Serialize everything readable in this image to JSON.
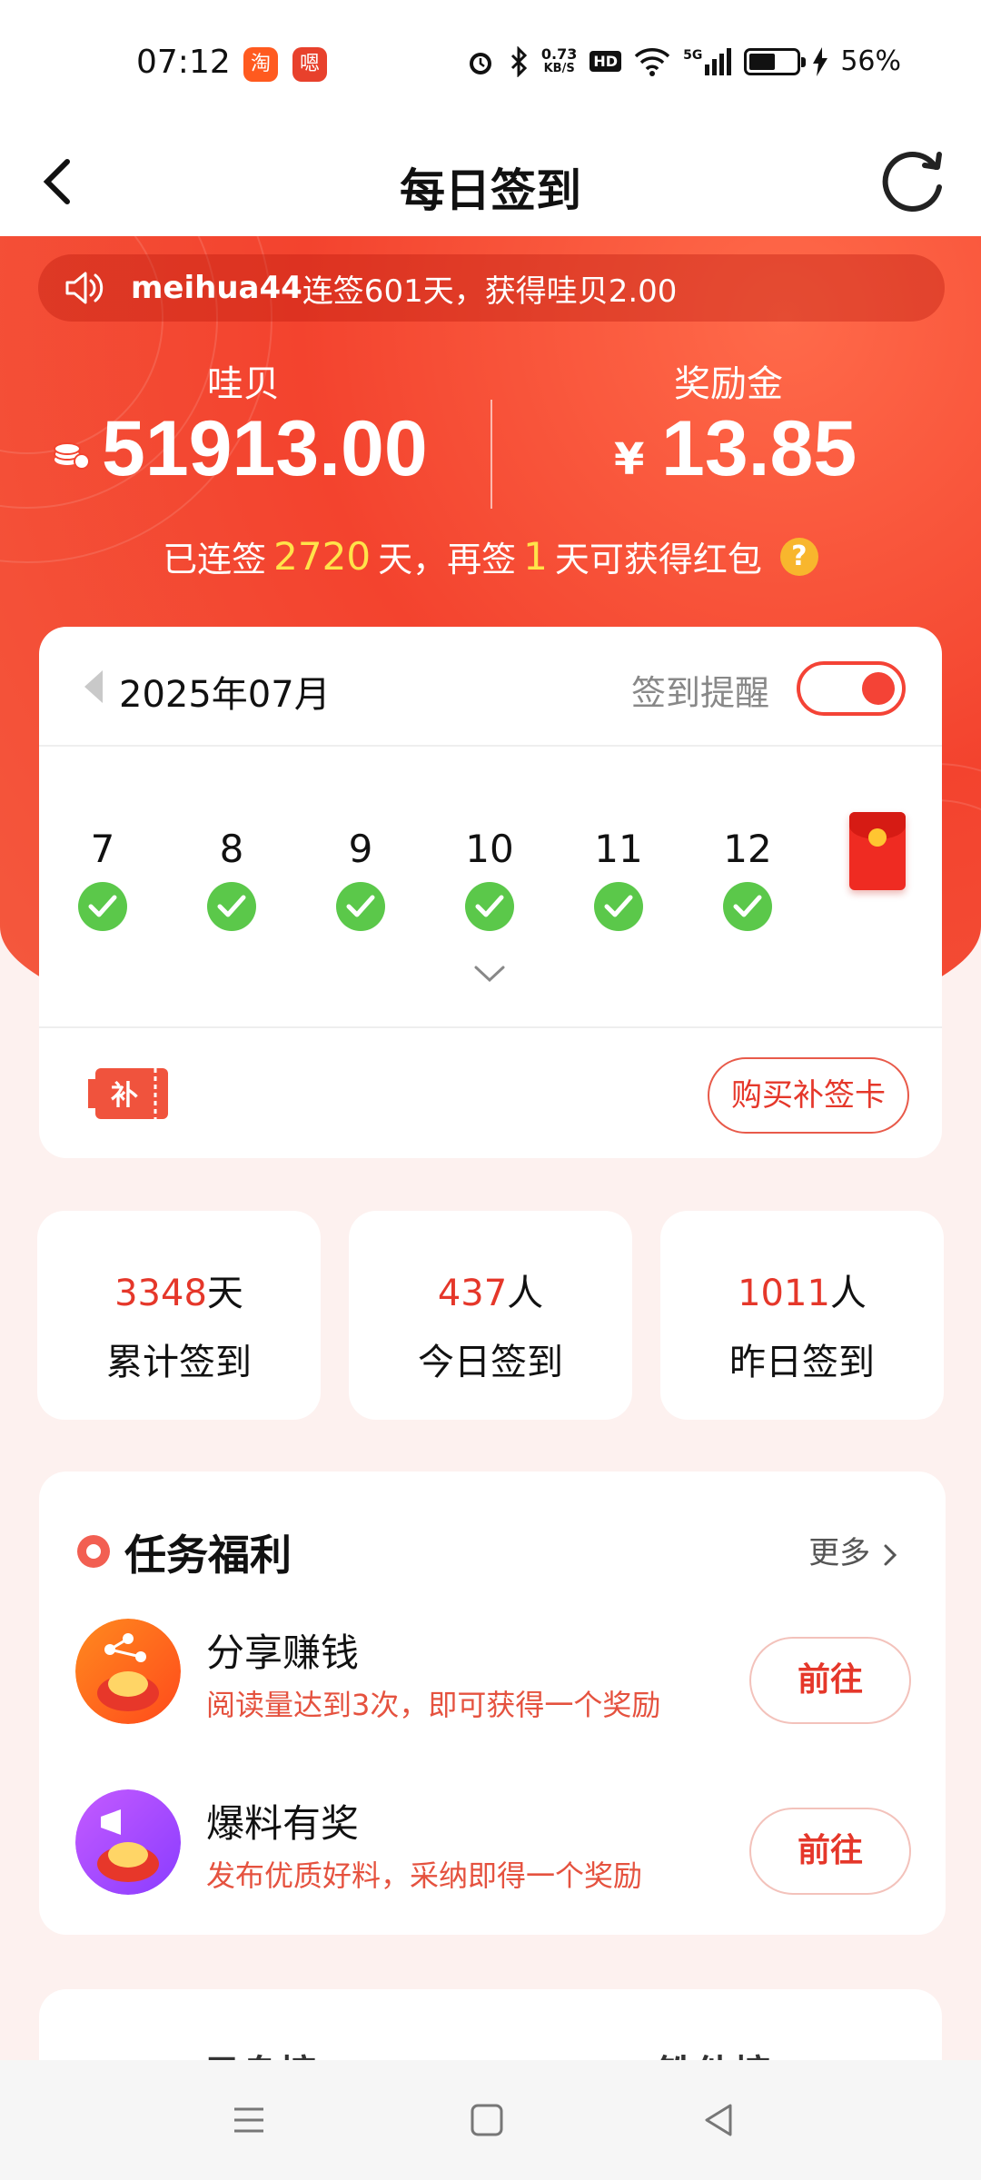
{
  "status_bar": {
    "time": "07:12",
    "app_icons": [
      {
        "name": "taobao-icon",
        "label": "淘",
        "color": "#ff5a1f"
      },
      {
        "name": "app-icon",
        "label": "嗯",
        "color": "#e8412c"
      }
    ],
    "net_speed": "0.73",
    "net_unit": "KB/S",
    "hd": "HD",
    "signal": "5G",
    "battery": "56%"
  },
  "header": {
    "title": "每日签到"
  },
  "marquee": {
    "user": "meihua44",
    "text": "连签601天，获得哇贝2.00"
  },
  "summary": {
    "wabei_label": "哇贝",
    "wabei_value": "51913.00",
    "bonus_label": "奖励金",
    "bonus_currency": "¥",
    "bonus_value": "13.85"
  },
  "streak": {
    "prefix": "已连签",
    "days": "2720",
    "mid": "天，再签",
    "remaining": "1",
    "suffix": "天可获得红包",
    "help": "?"
  },
  "calendar": {
    "month": "2025年07月",
    "remind_label": "签到提醒",
    "remind_on": true,
    "days": [
      {
        "day": "7",
        "signed": true
      },
      {
        "day": "8",
        "signed": true
      },
      {
        "day": "9",
        "signed": true
      },
      {
        "day": "10",
        "signed": true
      },
      {
        "day": "11",
        "signed": true
      },
      {
        "day": "12",
        "signed": true
      }
    ],
    "makeup_icon_text": "补",
    "buy_makeup_label": "购买补签卡"
  },
  "stats": [
    {
      "value": "3348",
      "unit": "天",
      "label": "累计签到"
    },
    {
      "value": "437",
      "unit": "人",
      "label": "今日签到"
    },
    {
      "value": "1011",
      "unit": "人",
      "label": "昨日签到"
    }
  ],
  "tasks": {
    "title": "任务福利",
    "more": "更多",
    "items": [
      {
        "name": "分享赚钱",
        "desc": "阅读量达到3次，即可获得一个奖励",
        "button": "前往"
      },
      {
        "name": "爆料有奖",
        "desc": "发布优质好料，采纳即得一个奖励",
        "button": "前往"
      }
    ]
  },
  "ranking": {
    "tabs": [
      "日身榜",
      "铁他榜"
    ]
  },
  "colors": {
    "primary_red": "#f3432e",
    "accent_yellow": "#ffe34a",
    "check_green": "#5bc84a"
  }
}
